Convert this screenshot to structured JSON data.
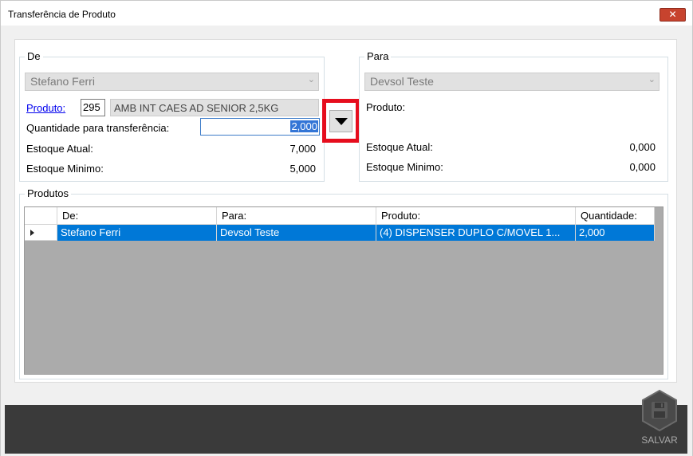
{
  "window": {
    "title": "Transferência de Produto",
    "close_glyph": "✕"
  },
  "de": {
    "legend": "De",
    "combo_value": "Stefano Ferri",
    "produto_label": "Produto:",
    "produto_code": "295",
    "produto_desc": "AMB INT CAES AD SENIOR 2,5KG",
    "quantidade_label": "Quantidade para transferência:",
    "quantidade_value": "2,000",
    "estoque_atual_label": "Estoque Atual:",
    "estoque_atual_value": "7,000",
    "estoque_minimo_label": "Estoque Minimo:",
    "estoque_minimo_value": "5,000"
  },
  "para": {
    "legend": "Para",
    "combo_value": "Devsol Teste",
    "produto_label": "Produto:",
    "estoque_atual_label": "Estoque Atual:",
    "estoque_atual_value": "0,000",
    "estoque_minimo_label": "Estoque Minimo:",
    "estoque_minimo_value": "0,000"
  },
  "transfer_button": {
    "icon": "triangle-down-icon"
  },
  "produtos": {
    "legend": "Produtos",
    "columns": [
      "De:",
      "Para:",
      "Produto:",
      "Quantidade:"
    ],
    "rows": [
      {
        "de": "Stefano Ferri",
        "para": "Devsol Teste",
        "produto": "(4) DISPENSER DUPLO C/MOVEL 1...",
        "quantidade": "2,000"
      }
    ]
  },
  "footer": {
    "save_label": "SALVAR",
    "save_icon": "floppy-disk-icon"
  },
  "colors": {
    "highlight": "#e60d1d",
    "selection": "#0078d7",
    "footer": "#3a3a3a",
    "close": "#c7432e"
  }
}
